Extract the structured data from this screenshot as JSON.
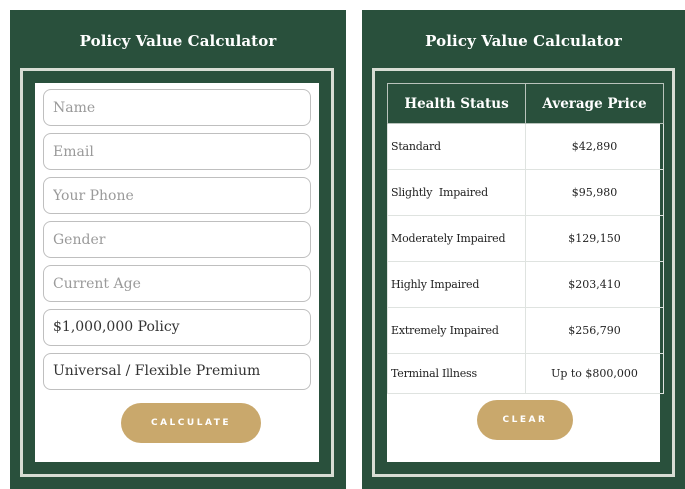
{
  "left_panel": {
    "title": "Policy Value Calculator",
    "fields": [
      {
        "placeholder": "Name",
        "value": ""
      },
      {
        "placeholder": "Email",
        "value": ""
      },
      {
        "placeholder": "Your Phone",
        "value": ""
      },
      {
        "placeholder": "Gender",
        "value": ""
      },
      {
        "placeholder": "Current Age",
        "value": ""
      },
      {
        "placeholder": "",
        "value": "$1,000,000 Policy"
      },
      {
        "placeholder": "",
        "value": "Universal / Flexible Premium"
      }
    ],
    "calculate_label": "CALCULATE"
  },
  "right_panel": {
    "title": "Policy Value Calculator",
    "table": {
      "headers": [
        "Health Status",
        "Average Price"
      ],
      "rows": [
        {
          "status": "Standard",
          "price": "$42,890"
        },
        {
          "status": "Slightly  Impaired",
          "price": "$95,980"
        },
        {
          "status": "Moderately Impaired",
          "price": "$129,150"
        },
        {
          "status": "Highly Impaired",
          "price": "$203,410"
        },
        {
          "status": "Extremely Impaired",
          "price": "$256,790"
        },
        {
          "status": "Terminal Illness",
          "price": "Up to $800,000"
        }
      ]
    },
    "clear_label": "CLEAR"
  },
  "colors": {
    "panel_green": "#29503c",
    "button_gold": "#c9a86c",
    "frame_border": "#d7ddd4"
  }
}
